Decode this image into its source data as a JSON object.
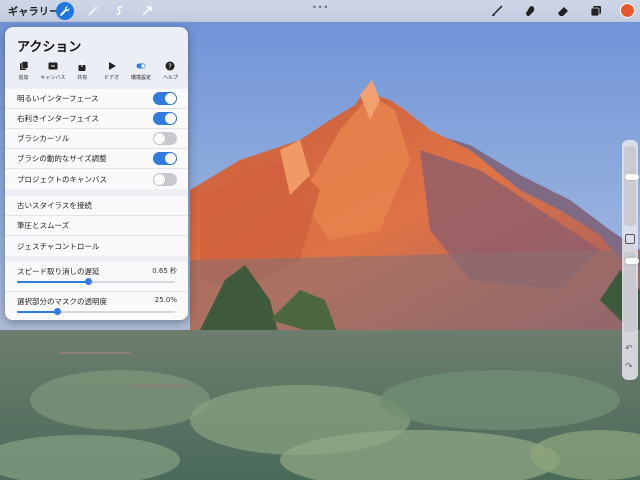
{
  "topbar": {
    "gallery_label": "ギャラリー",
    "tools_left": [
      "wrench-icon",
      "magic-wand-icon",
      "selection-icon",
      "arrow-cursor-icon"
    ],
    "tools_right": [
      "brush-icon",
      "smudge-icon",
      "eraser-icon",
      "layers-icon"
    ],
    "current_color": "#e8562e"
  },
  "panel": {
    "title": "アクション",
    "tabs": [
      {
        "label": "追加",
        "icon": "add-icon"
      },
      {
        "label": "キャンバス",
        "icon": "canvas-icon"
      },
      {
        "label": "共有",
        "icon": "share-icon"
      },
      {
        "label": "ビデオ",
        "icon": "play-icon"
      },
      {
        "label": "環境設定",
        "icon": "toggle-icon"
      },
      {
        "label": "ヘルプ",
        "icon": "help-icon"
      }
    ],
    "selected_tab": "環境設定",
    "toggles": [
      {
        "label": "明るいインターフェース",
        "on": true
      },
      {
        "label": "右利きインターフェイス",
        "on": true
      },
      {
        "label": "ブラシカーソル",
        "on": false
      },
      {
        "label": "ブラシの動的なサイズ調整",
        "on": true
      },
      {
        "label": "プロジェクトのキャンバス",
        "on": false
      }
    ],
    "links": [
      {
        "label": "古いスタイラスを接続"
      },
      {
        "label": "筆圧とスムーズ"
      },
      {
        "label": "ジェスチャコントロール"
      }
    ],
    "sliders": [
      {
        "label": "スピード取り消しの遅延",
        "value": "0.65 秒",
        "fraction": 0.45
      },
      {
        "label": "選択部分のマスクの透明度",
        "value": "25.0%",
        "fraction": 0.25
      }
    ]
  },
  "accent_color": "#2f7bde"
}
